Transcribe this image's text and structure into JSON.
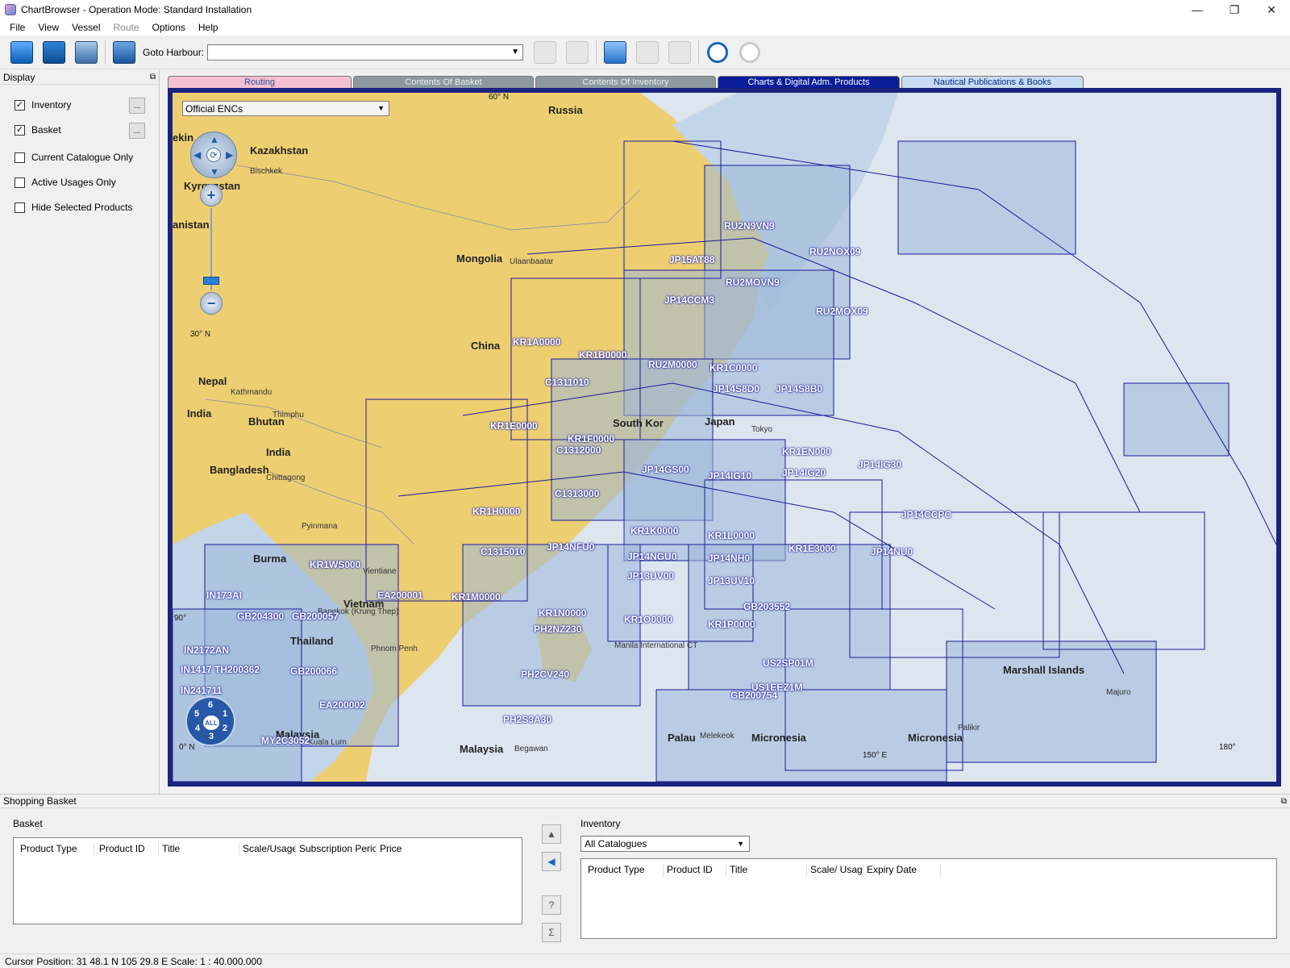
{
  "window": {
    "title": "ChartBrowser - Operation Mode: Standard Installation"
  },
  "menu": {
    "items": [
      {
        "label": "File",
        "enabled": true
      },
      {
        "label": "View",
        "enabled": true
      },
      {
        "label": "Vessel",
        "enabled": true
      },
      {
        "label": "Route",
        "enabled": false
      },
      {
        "label": "Options",
        "enabled": true
      },
      {
        "label": "Help",
        "enabled": true
      }
    ]
  },
  "toolbar": {
    "goto_label": "Goto Harbour:",
    "goto_value": "",
    "icons": [
      "open-folder-icon",
      "save-icon",
      "vessel-icon",
      "binoculars-icon",
      "zoom-extent-icon",
      "zoom-fit-icon",
      "select-arrow-icon",
      "basket-add-icon",
      "basket-remove-icon",
      "undo-icon",
      "redo-icon"
    ]
  },
  "display_panel": {
    "title": "Display",
    "options": [
      {
        "label": "Inventory",
        "checked": true,
        "has_button": true
      },
      {
        "label": "Basket",
        "checked": true,
        "has_button": true
      },
      {
        "label": "Current Catalogue Only",
        "checked": false,
        "has_button": false
      },
      {
        "label": "Active Usages Only",
        "checked": false,
        "has_button": false
      },
      {
        "label": "Hide Selected Products",
        "checked": false,
        "has_button": false
      }
    ],
    "button_label": "..."
  },
  "tabs": [
    {
      "label": "Routing"
    },
    {
      "label": "Contents Of Basket"
    },
    {
      "label": "Contents Of Inventory"
    },
    {
      "label": "Charts & Digital Adm. Products"
    },
    {
      "label": "Nautical Publications & Books"
    }
  ],
  "map": {
    "product_filter": "Official ENCs",
    "usage_buttons": [
      "6",
      "1",
      "2",
      "3",
      "4",
      "5",
      "ALL"
    ],
    "colors": {
      "land": "#edcf72",
      "sea": "#dde5ef",
      "chart_fill": "#9db8d9",
      "chart_line": "#1a1a9a"
    },
    "lat_labels": [
      "60° N",
      "30° N",
      "90°",
      "0° N"
    ],
    "lon_labels": [
      "150° E",
      "180°"
    ],
    "places": [
      {
        "text": "Russia",
        "bold": true
      },
      {
        "text": "Kazakhstan",
        "bold": true
      },
      {
        "text": "Bischkek",
        "bold": false
      },
      {
        "text": "Kyrgyzstan",
        "bold": true
      },
      {
        "text": "anistan",
        "bold": true
      },
      {
        "text": "Mongolia",
        "bold": true
      },
      {
        "text": "Ulaanbaatar",
        "bold": false
      },
      {
        "text": "China",
        "bold": true
      },
      {
        "text": "Nepal",
        "bold": true
      },
      {
        "text": "Kathmandu",
        "bold": false
      },
      {
        "text": "India",
        "bold": true
      },
      {
        "text": "Bhutan",
        "bold": true
      },
      {
        "text": "Thimphu",
        "bold": false
      },
      {
        "text": "India",
        "bold": true
      },
      {
        "text": "Bangladesh",
        "bold": true
      },
      {
        "text": "Chittagong",
        "bold": false
      },
      {
        "text": "Pyinmana",
        "bold": false
      },
      {
        "text": "Burma",
        "bold": true
      },
      {
        "text": "Vietnam",
        "bold": true
      },
      {
        "text": "Vientiane",
        "bold": false
      },
      {
        "text": "Bangkok (Krung Thep)",
        "bold": false
      },
      {
        "text": "Thailand",
        "bold": true
      },
      {
        "text": "Phnom Penh",
        "bold": false
      },
      {
        "text": "Malaysia",
        "bold": true
      },
      {
        "text": "Kuala Lum",
        "bold": false
      },
      {
        "text": "Malaysia",
        "bold": true
      },
      {
        "text": "Japan",
        "bold": true
      },
      {
        "text": "Tokyo",
        "bold": false
      },
      {
        "text": "South Kor",
        "bold": true
      },
      {
        "text": "Manila International CT",
        "bold": false
      },
      {
        "text": "Palau",
        "bold": true
      },
      {
        "text": "Melekeok",
        "bold": false
      },
      {
        "text": "Micronesia",
        "bold": true
      },
      {
        "text": "Micronesia",
        "bold": true
      },
      {
        "text": "Palikir",
        "bold": false
      },
      {
        "text": "Marshall Islands",
        "bold": true
      },
      {
        "text": "Majuro",
        "bold": false
      },
      {
        "text": "Begawan",
        "bold": false
      },
      {
        "text": "ekin",
        "bold": true
      }
    ],
    "chart_ids": [
      "RU2N9VN9",
      "RU2NOX09",
      "JP15AT88",
      "RU2MOVN9",
      "JP14CCM3",
      "RU2MOX09",
      "KR1A0000",
      "KR1B0000",
      "RU2M0000",
      "KR1C0000",
      "JP14S8B0",
      "JP14S8D0",
      "C1311010",
      "KR1E0000",
      "KR1F0000",
      "JP14GS00",
      "KR1EN000",
      "JP14IG30",
      "JP14IG10",
      "JP14IG20",
      "C1312000",
      "C1313000",
      "KR1H0000",
      "JP14CCPC",
      "KR1K0000",
      "KR1L0000",
      "KR1E3000",
      "JP14NU0",
      "JP14NFU0",
      "JP14NGU0",
      "JP14NH0",
      "C1315010",
      "JP13UV00",
      "JP13UV10",
      "KR1WS000",
      "KR1M0000",
      "EA200001",
      "KR1N0000",
      "KR1O0000",
      "KR1P0000",
      "GB203552",
      "IN173AI",
      "GB204300",
      "GB200057",
      "IN2172AN",
      "IN1417",
      "TH200362",
      "GB200066",
      "IN241711",
      "EA200002",
      "PH2NZ230",
      "PH2CV240",
      "US2SP01M",
      "US1EEZ1M",
      "GB200754",
      "PH2S3A30",
      "MY2C3052"
    ]
  },
  "shopping_basket": {
    "title": "Shopping Basket",
    "basket_label": "Basket",
    "basket_columns": [
      "Product Type",
      "Product ID",
      "Title",
      "Scale/Usage",
      "Subscription Period",
      "Price"
    ],
    "inventory_label": "Inventory",
    "inventory_filter": "All Catalogues",
    "inventory_columns": [
      "Product Type",
      "Product ID",
      "Title",
      "Scale/ Usage",
      "Expiry Date"
    ]
  },
  "status": {
    "cursor": "Cursor Position:  31 48.1 N   105 29.8 E Scale: 1 : 40.000.000"
  }
}
